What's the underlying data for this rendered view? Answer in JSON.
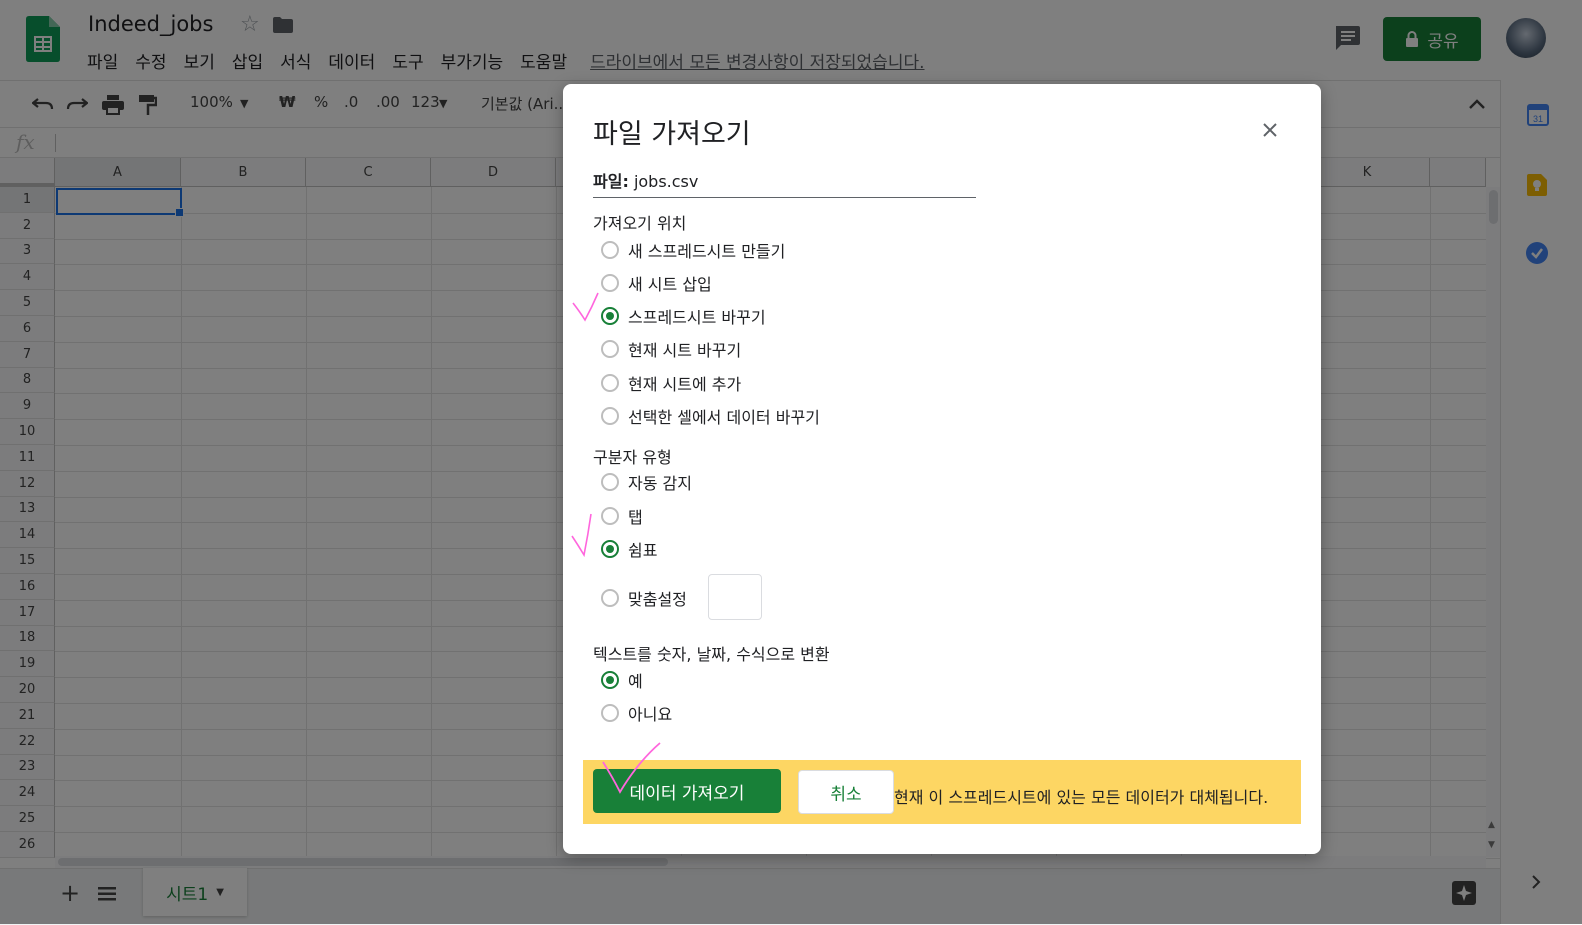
{
  "app": {
    "doc_title": "Indeed_jobs",
    "menu": [
      "파일",
      "수정",
      "보기",
      "삽입",
      "서식",
      "데이터",
      "도구",
      "부가기능",
      "도움말"
    ],
    "save_status": "드라이브에서 모든 변경사항이 저장되었습니다.",
    "share_label": "공유"
  },
  "toolbar": {
    "zoom": "100%",
    "currency": "₩",
    "percent": "%",
    "dec_less": ".0",
    "dec_more": ".00",
    "format_more": "123",
    "font": "기본값 (Ari..."
  },
  "formula": {
    "fx": "fx"
  },
  "grid": {
    "columns": [
      "A",
      "B",
      "C",
      "D",
      "K"
    ],
    "rows": [
      "1",
      "2",
      "3",
      "4",
      "5",
      "6",
      "7",
      "8",
      "9",
      "10",
      "11",
      "12",
      "13",
      "14",
      "15",
      "16",
      "17",
      "18",
      "19",
      "20",
      "21",
      "22",
      "23",
      "24",
      "25",
      "26"
    ]
  },
  "sheets": {
    "tab_label": "시트1"
  },
  "dialog": {
    "title": "파일 가져오기",
    "file_label": "파일:",
    "file_name": "jobs.csv",
    "location": {
      "label": "가져오기 위치",
      "options": [
        {
          "label": "새 스프레드시트 만들기",
          "selected": false
        },
        {
          "label": "새 시트 삽입",
          "selected": false
        },
        {
          "label": "스프레드시트 바꾸기",
          "selected": true
        },
        {
          "label": "현재 시트 바꾸기",
          "selected": false
        },
        {
          "label": "현재 시트에 추가",
          "selected": false
        },
        {
          "label": "선택한 셀에서 데이터 바꾸기",
          "selected": false
        }
      ]
    },
    "separator": {
      "label": "구분자 유형",
      "options": [
        {
          "label": "자동 감지",
          "selected": false
        },
        {
          "label": "탭",
          "selected": false
        },
        {
          "label": "쉼표",
          "selected": true
        },
        {
          "label": "맞춤설정",
          "selected": false
        }
      ],
      "custom_value": ""
    },
    "convert": {
      "label": "텍스트를 숫자, 날짜, 수식으로 변환",
      "options": [
        {
          "label": "예",
          "selected": true
        },
        {
          "label": "아니요",
          "selected": false
        }
      ]
    },
    "import_button": "데이터 가져오기",
    "cancel_button": "취소",
    "warning": "현재 이 스프레드시트에 있는 모든 데이터가 대체됩니다."
  },
  "colors": {
    "accent": "#188038",
    "warning_bg": "#fdd663",
    "annotation": "#ff66dd"
  }
}
